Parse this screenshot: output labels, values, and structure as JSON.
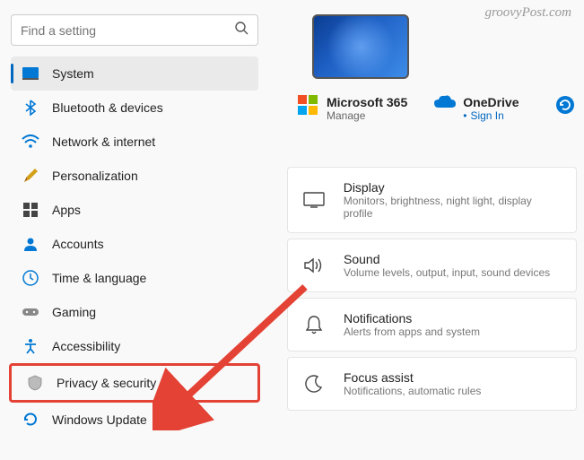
{
  "search": {
    "placeholder": "Find a setting"
  },
  "sidebar": {
    "items": [
      {
        "label": "System"
      },
      {
        "label": "Bluetooth & devices"
      },
      {
        "label": "Network & internet"
      },
      {
        "label": "Personalization"
      },
      {
        "label": "Apps"
      },
      {
        "label": "Accounts"
      },
      {
        "label": "Time & language"
      },
      {
        "label": "Gaming"
      },
      {
        "label": "Accessibility"
      },
      {
        "label": "Privacy & security"
      },
      {
        "label": "Windows Update"
      }
    ]
  },
  "cloud": {
    "ms365": {
      "title": "Microsoft 365",
      "sub": "Manage"
    },
    "onedrive": {
      "title": "OneDrive",
      "sub": "Sign In"
    }
  },
  "cards": [
    {
      "title": "Display",
      "desc": "Monitors, brightness, night light, display profile"
    },
    {
      "title": "Sound",
      "desc": "Volume levels, output, input, sound devices"
    },
    {
      "title": "Notifications",
      "desc": "Alerts from apps and system"
    },
    {
      "title": "Focus assist",
      "desc": "Notifications, automatic rules"
    }
  ],
  "watermark": "groovyPost.com"
}
